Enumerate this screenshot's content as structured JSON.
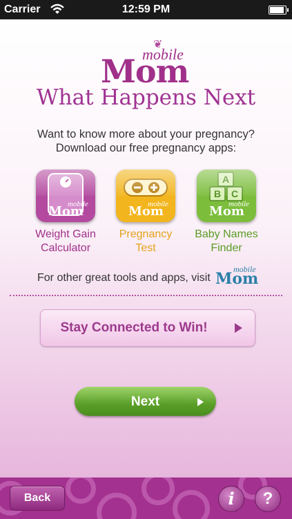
{
  "status": {
    "carrier": "Carrier",
    "time": "12:59 PM",
    "battery_level": 0.95
  },
  "logo": {
    "small": "mobile",
    "large": "Mom"
  },
  "title": "What Happens Next",
  "intro": {
    "line1": "Want to know more about your pregnancy?",
    "line2": "Download our free pregnancy apps:"
  },
  "apps": [
    {
      "line1": "Weight Gain",
      "line2": "Calculator",
      "color": "#a0308a",
      "icon_bg": "#b44aa0",
      "icon": "scale-icon"
    },
    {
      "line1": "Pregnancy",
      "line2": "Test",
      "color": "#e3a21a",
      "icon_bg": "#f2b51d",
      "icon": "pregnancy-test-icon"
    },
    {
      "line1": "Baby Names",
      "line2": "Finder",
      "color": "#5a9c25",
      "icon_bg": "#7cbd3c",
      "icon": "abc-blocks-icon"
    }
  ],
  "icon_brand": {
    "small": "mobile",
    "large": "Mom"
  },
  "visit": {
    "text": "For other great tools and apps, visit",
    "logo_small": "mobile",
    "logo_large": "Mom"
  },
  "stay_button": {
    "label": "Stay Connected to Win!"
  },
  "next_button": {
    "label": "Next"
  },
  "bottom": {
    "back_label": "Back",
    "info_label": "i",
    "help_label": "?"
  }
}
